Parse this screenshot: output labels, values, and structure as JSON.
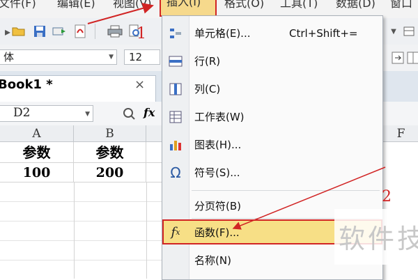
{
  "menubar": {
    "items": [
      "文件(F)",
      "编辑(E)",
      "视图(V)",
      "插入(I)",
      "格式(O)",
      "工具(T)",
      "数据(D)",
      "窗口"
    ]
  },
  "format_bar": {
    "font_name": "体",
    "font_size": "12"
  },
  "tab": {
    "title": "Book1 *",
    "close": "×"
  },
  "formula_bar": {
    "cell_ref": "D2",
    "fx": "fx"
  },
  "sheet": {
    "columns": [
      "A",
      "B",
      "F"
    ],
    "rows": [
      [
        "参数",
        "参数"
      ],
      [
        "100",
        "200"
      ]
    ]
  },
  "insert_menu": {
    "items": [
      {
        "icon": "cell-icon",
        "label": "单元格(E)...",
        "shortcut": "Ctrl+Shift+="
      },
      {
        "icon": "row-icon",
        "label": "行(R)",
        "shortcut": ""
      },
      {
        "icon": "column-icon",
        "label": "列(C)",
        "shortcut": ""
      },
      {
        "icon": "worksheet-icon",
        "label": "工作表(W)",
        "shortcut": ""
      },
      {
        "icon": "chart-icon",
        "label": "图表(H)...",
        "shortcut": ""
      },
      {
        "icon": "omega-icon",
        "label": "符号(S)...",
        "shortcut": ""
      },
      {
        "icon": "",
        "label": "分页符(B)",
        "shortcut": ""
      },
      {
        "icon": "fx-icon",
        "label": "函数(F)...",
        "shortcut": ""
      },
      {
        "icon": "",
        "label": "名称(N)",
        "shortcut": ""
      }
    ]
  },
  "annotations": {
    "step1": "1",
    "step2": "2"
  },
  "watermark": "软件技",
  "colors": {
    "highlight": "#f7df86",
    "annotation_red": "#d12424"
  }
}
